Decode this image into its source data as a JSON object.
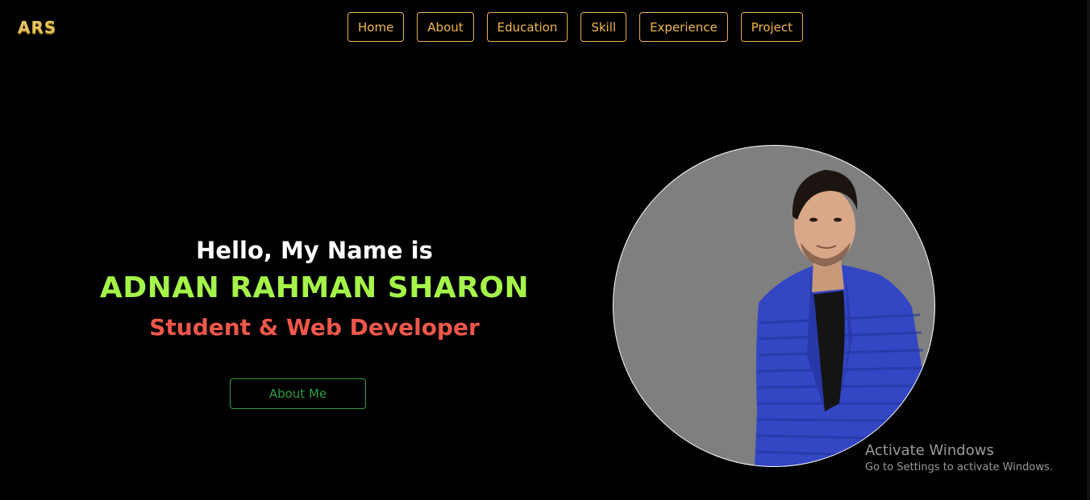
{
  "logo": {
    "text": "ARS"
  },
  "nav": {
    "items": [
      {
        "label": "Home"
      },
      {
        "label": "About"
      },
      {
        "label": "Education"
      },
      {
        "label": "Skill"
      },
      {
        "label": "Experience"
      },
      {
        "label": "Project"
      }
    ]
  },
  "hero": {
    "greeting": "Hello, My Name is",
    "name": "ADNAN RAHMAN SHARON",
    "role": "Student & Web Developer",
    "cta_label": "About Me"
  },
  "portrait": {
    "icon": "person-photo",
    "background": "#7f7f7f"
  },
  "watermark": {
    "title": "Activate Windows",
    "subtitle": "Go to Settings to activate Windows."
  },
  "colors": {
    "nav_accent": "#f0b64a",
    "name_color": "#a5f548",
    "role_color": "#f0574a",
    "cta_color": "#2e9e46"
  }
}
